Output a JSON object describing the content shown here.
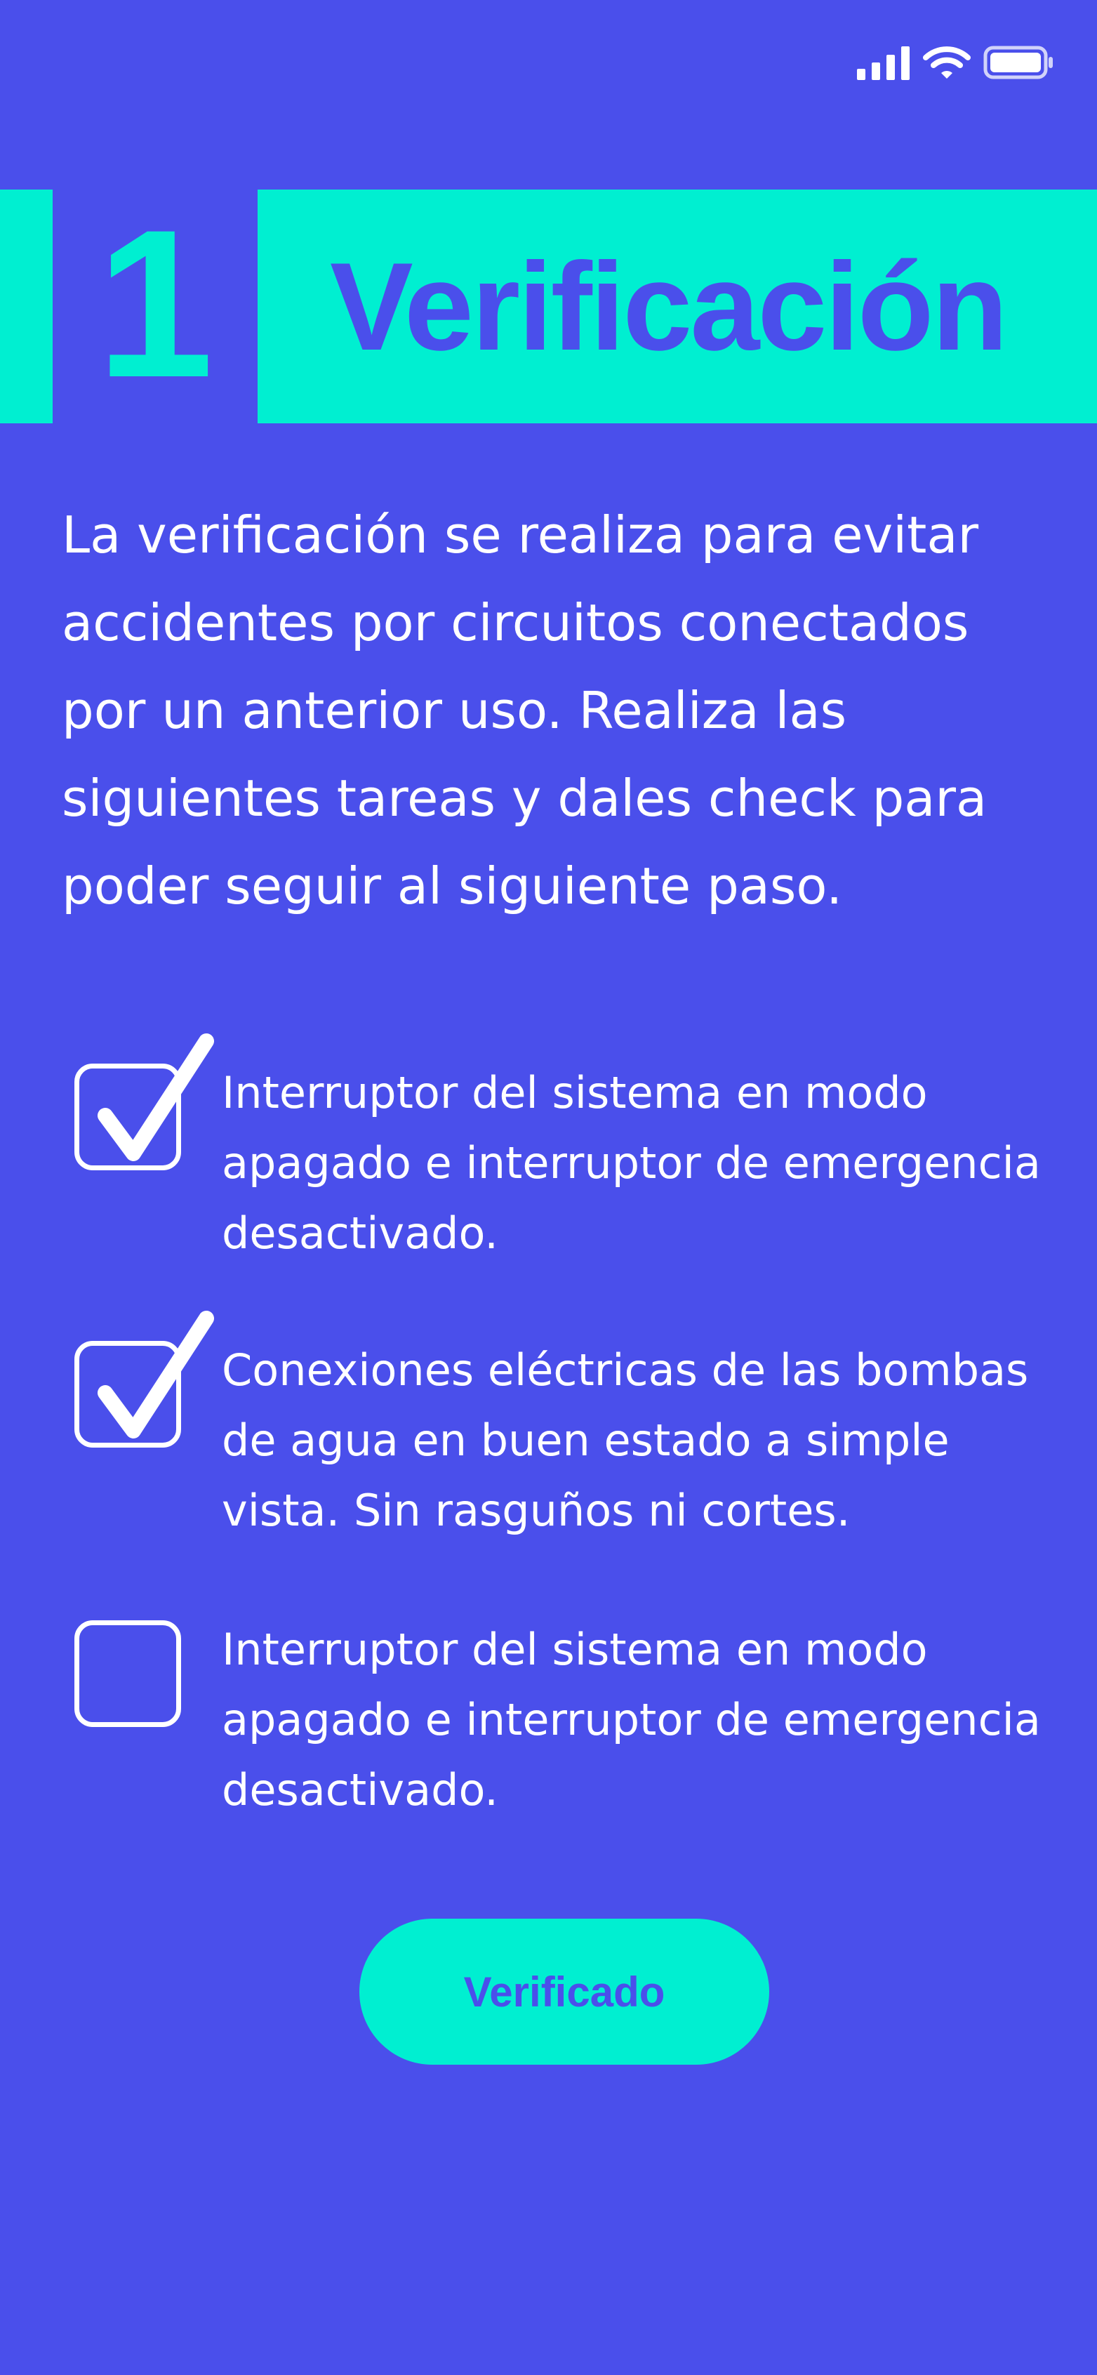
{
  "status_bar": {
    "icons": [
      "signal-icon",
      "wifi-icon",
      "battery-icon"
    ]
  },
  "header": {
    "step_number": "1",
    "title": "Verificación"
  },
  "intro_text": "La verificación se realiza para evitar accidentes por circuitos conectados por un anterior uso. Realiza las siguientes tareas y dales check para poder seguir al siguiente paso.",
  "checklist": [
    {
      "checked": true,
      "text": "Interruptor del sistema en modo apagado e interruptor de emergencia desactivado."
    },
    {
      "checked": true,
      "text": "Conexiones eléctricas de las bombas de agua en buen estado a simple vista. Sin rasguños ni cortes."
    },
    {
      "checked": false,
      "text": "Interruptor del sistema en modo apagado e interruptor de emergencia desactivado."
    }
  ],
  "button": {
    "label": "Verificado"
  },
  "colors": {
    "background": "#4a4feb",
    "accent": "#00efd1",
    "text": "#ffffff"
  }
}
